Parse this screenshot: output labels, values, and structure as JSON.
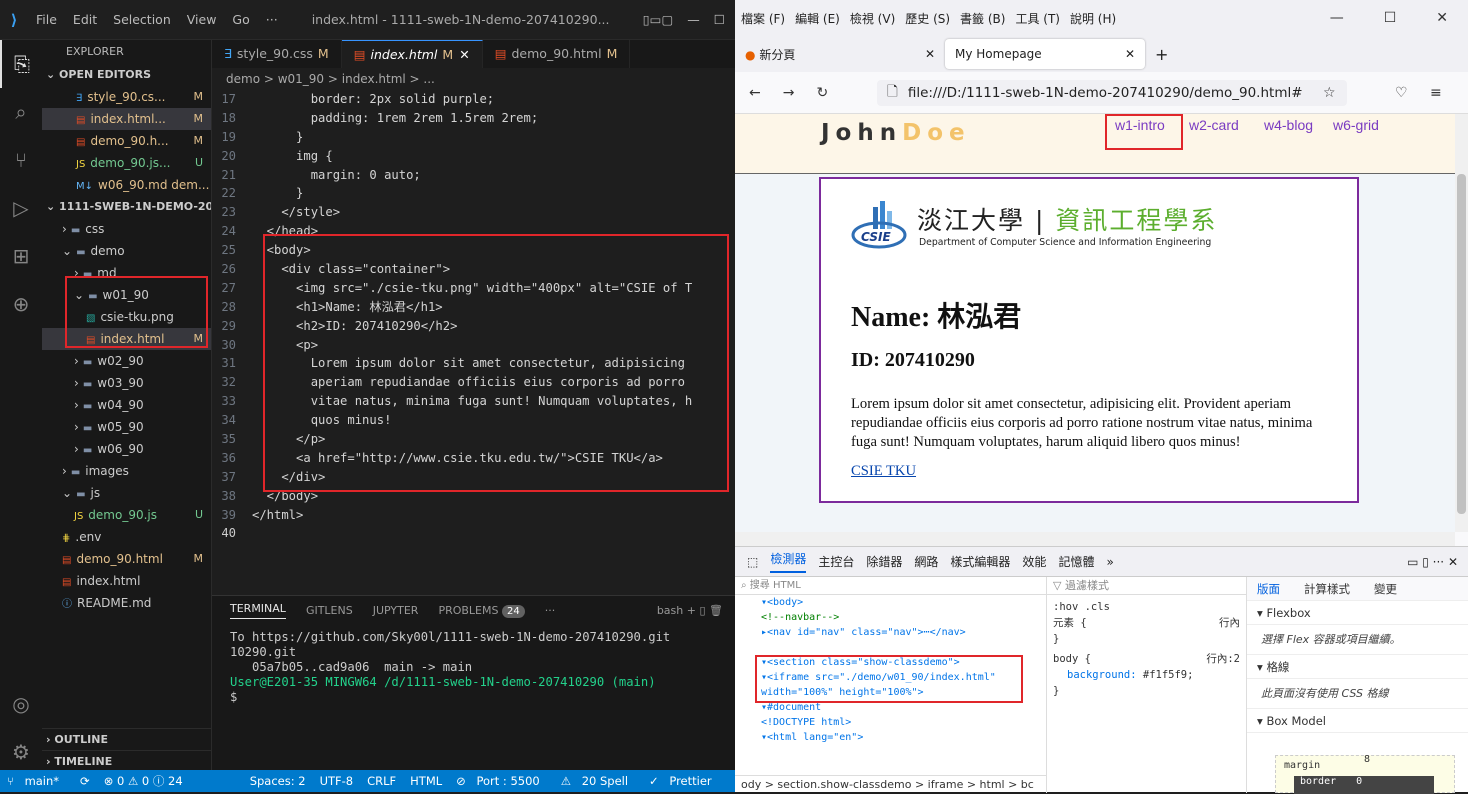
{
  "vscode": {
    "menu": [
      "File",
      "Edit",
      "Selection",
      "View",
      "Go",
      "···"
    ],
    "window_title": "index.html - 1111-sweb-1N-demo-207410290...",
    "explorer_title": "EXPLORER",
    "open_editors_label": "OPEN EDITORS",
    "open_editors": [
      {
        "icon": "css",
        "name": "style_90.cs...",
        "status": "M"
      },
      {
        "icon": "html",
        "name": "index.html...",
        "status": "M"
      },
      {
        "icon": "html",
        "name": "demo_90.h...",
        "status": "M"
      },
      {
        "icon": "js",
        "name": "demo_90.js...",
        "status": "U"
      },
      {
        "icon": "md",
        "name": "w06_90.md dem...",
        "status": ""
      }
    ],
    "workspace_label": "1111-SWEB-1N-DEMO-20...",
    "tree": [
      {
        "label": "css",
        "indent": 1,
        "type": "folder"
      },
      {
        "label": "demo",
        "indent": 1,
        "type": "folder"
      },
      {
        "label": "md",
        "indent": 2,
        "type": "folder"
      },
      {
        "label": "w01_90",
        "indent": 2,
        "type": "folder"
      },
      {
        "label": "csie-tku.png",
        "indent": 3,
        "type": "png"
      },
      {
        "label": "index.html",
        "indent": 3,
        "type": "html",
        "status": "M"
      },
      {
        "label": "w02_90",
        "indent": 2,
        "type": "folder"
      },
      {
        "label": "w03_90",
        "indent": 2,
        "type": "folder"
      },
      {
        "label": "w04_90",
        "indent": 2,
        "type": "folder"
      },
      {
        "label": "w05_90",
        "indent": 2,
        "type": "folder"
      },
      {
        "label": "w06_90",
        "indent": 2,
        "type": "folder"
      },
      {
        "label": "images",
        "indent": 1,
        "type": "folder"
      },
      {
        "label": "js",
        "indent": 1,
        "type": "folder"
      },
      {
        "label": "demo_90.js",
        "indent": 2,
        "type": "js",
        "status": "U"
      },
      {
        "label": ".env",
        "indent": 1,
        "type": "env"
      },
      {
        "label": "demo_90.html",
        "indent": 1,
        "type": "html",
        "status": "M"
      },
      {
        "label": "index.html",
        "indent": 1,
        "type": "html"
      },
      {
        "label": "README.md",
        "indent": 1,
        "type": "info"
      }
    ],
    "outline_label": "OUTLINE",
    "timeline_label": "TIMELINE",
    "tabs": [
      {
        "label": "style_90.css",
        "status": "M"
      },
      {
        "label": "index.html",
        "status": "M"
      },
      {
        "label": "demo_90.html",
        "status": "M"
      }
    ],
    "breadcrumb": "demo > w01_90 > index.html > ...",
    "code_lines": [
      {
        "n": "17",
        "t": "        border: 2px solid purple;"
      },
      {
        "n": "18",
        "t": "        padding: 1rem 2rem 1.5rem 2rem;"
      },
      {
        "n": "19",
        "t": "      }"
      },
      {
        "n": "20",
        "t": "      img {"
      },
      {
        "n": "21",
        "t": "        margin: 0 auto;"
      },
      {
        "n": "22",
        "t": "      }"
      },
      {
        "n": "23",
        "t": "    </style>"
      },
      {
        "n": "24",
        "t": "  </head>"
      },
      {
        "n": "25",
        "t": "  <body>"
      },
      {
        "n": "26",
        "t": "    <div class=\"container\">"
      },
      {
        "n": "27",
        "t": "      <img src=\"./csie-tku.png\" width=\"400px\" alt=\"CSIE of T"
      },
      {
        "n": "28",
        "t": "      <h1>Name: 林泓君</h1>"
      },
      {
        "n": "29",
        "t": "      <h2>ID: 207410290</h2>"
      },
      {
        "n": "30",
        "t": "      <p>"
      },
      {
        "n": "31",
        "t": "        Lorem ipsum dolor sit amet consectetur, adipisicing"
      },
      {
        "n": "32",
        "t": "        aperiam repudiandae officiis eius corporis ad porro"
      },
      {
        "n": "33",
        "t": "        vitae natus, minima fuga sunt! Numquam voluptates, h"
      },
      {
        "n": "34",
        "t": "        quos minus!"
      },
      {
        "n": "35",
        "t": "      </p>"
      },
      {
        "n": "36",
        "t": "      <a href=\"http://www.csie.tku.edu.tw/\">CSIE TKU</a>"
      },
      {
        "n": "37",
        "t": "    </div>"
      },
      {
        "n": "38",
        "t": "  </body>"
      },
      {
        "n": "39",
        "t": "</html>"
      },
      {
        "n": "40",
        "t": ""
      }
    ],
    "terminal_tabs": [
      "TERMINAL",
      "GITLENS",
      "JUPYTER",
      "PROBLEMS"
    ],
    "problems_count": "24",
    "terminal_shell": "bash",
    "terminal_lines": [
      "To https://github.com/Sky00l/1111-sweb-1N-demo-207410290.git",
      "10290.git",
      "   05a7b05..cad9a06  main -> main",
      "",
      "User@E201-35 MINGW64 /d/1111-sweb-1N-demo-207410290 (main)",
      "$ "
    ],
    "status": {
      "branch": "main*",
      "problems": "⊗ 0 ⚠ 0 ⓘ 24",
      "spaces": "Spaces: 2",
      "encoding": "UTF-8",
      "eol": "CRLF",
      "lang": "HTML",
      "port": "Port : 5500",
      "spell": "20 Spell",
      "prettier": "Prettier"
    }
  },
  "firefox": {
    "menu": [
      "檔案 (F)",
      "編輯 (E)",
      "檢視 (V)",
      "歷史 (S)",
      "書籤 (B)",
      "工具 (T)",
      "說明 (H)"
    ],
    "tabs": [
      {
        "label": "新分頁"
      },
      {
        "label": "My Homepage"
      }
    ],
    "url": "file:///D:/1111-sweb-1N-demo-207410290/demo_90.html#",
    "site": {
      "logo_a": "John",
      "logo_b": "Doe",
      "nav": [
        "w1-intro",
        "w2-card",
        "w4-blog",
        "w6-grid"
      ],
      "logo_title_a": "淡江大學",
      "logo_title_b": "資訊工程學系",
      "logo_sub": "Department of Computer Science and Information Engineering",
      "logo_mark": "CSIE",
      "h1": "Name: 林泓君",
      "h2": "ID: 207410290",
      "paragraph": "Lorem ipsum dolor sit amet consectetur, adipisicing elit. Provident aperiam repudiandae officiis eius corporis ad porro ratione nostrum vitae natus, minima fuga sunt! Numquam voluptates, harum aliquid libero quos minus!",
      "link": "CSIE TKU"
    },
    "devtools": {
      "tabs": [
        "檢測器",
        "主控台",
        "除錯器",
        "網路",
        "樣式編輯器",
        "效能",
        "記憶體"
      ],
      "search_placeholder": "搜尋 HTML",
      "filter_placeholder": "過濾樣式",
      "html_lines": [
        "▾<body>",
        "  <!--navbar-->",
        "  ▸<nav id=\"nav\" class=\"nav\">⋯</nav>",
        "",
        "  ▾<section class=\"show-classdemo\">",
        "    ▾<iframe src=\"./demo/w01_90/index.html\"",
        "      width=\"100%\" height=\"100%\">",
        "      ▾#document",
        "        <!DOCTYPE html>",
        "        ▾<html lang=\"en\">"
      ],
      "html_breadcrumb": "ody > section.show-classdemo > iframe > html > bc",
      "rules": {
        "toolbar": ":hov .cls",
        "element_label": "元素 {",
        "inline": "行內",
        "body_sel": "body {",
        "body_src": "行內:2",
        "prop": "background:",
        "value": "#f1f5f9;",
        "close": "}"
      },
      "layout_tabs": [
        "版面",
        "計算樣式",
        "變更"
      ],
      "flexbox_label": "Flexbox",
      "flexbox_hint": "選擇 Flex 容器或項目繼續。",
      "grid_label": "格線",
      "grid_hint": "此頁面沒有使用 CSS 格線",
      "boxmodel_label": "Box Model",
      "box_margin": "margin",
      "box_margin_value": "8",
      "box_border": "border",
      "box_border_value": "0"
    }
  }
}
